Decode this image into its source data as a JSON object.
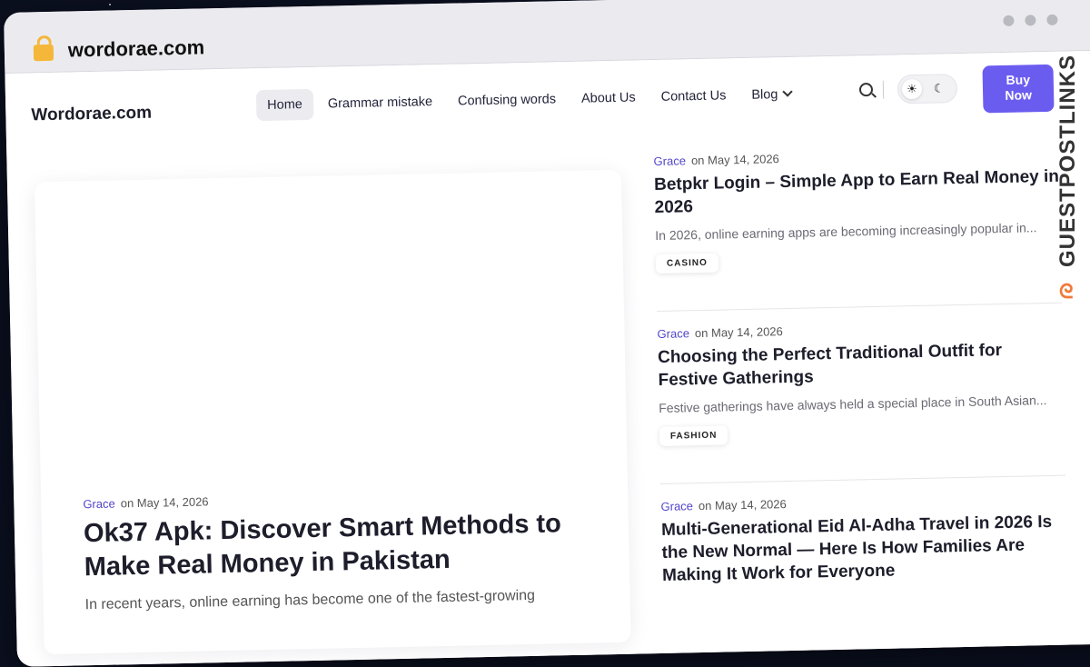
{
  "browser": {
    "url": "wordorae.com"
  },
  "site": {
    "logo": "Wordorae.com",
    "menu": [
      "Home",
      "Grammar mistake",
      "Confusing words",
      "About Us",
      "Contact Us",
      "Blog"
    ],
    "buy_label_line1": "Buy",
    "buy_label_line2": "Now"
  },
  "featured": {
    "author": "Grace",
    "date": "on May 14, 2026",
    "title": "Ok37 Apk: Discover Smart Methods to Make Real Money in Pakistan",
    "excerpt": "In recent years, online earning has become one of the fastest-growing"
  },
  "posts": [
    {
      "author": "Grace",
      "date": "on May 14, 2026",
      "title": "Betpkr Login – Simple App to Earn Real Money in 2026",
      "excerpt": "In 2026, online earning apps are becoming increasingly popular in...",
      "tag": "CASINO"
    },
    {
      "author": "Grace",
      "date": "on May 14, 2026",
      "title": "Choosing the Perfect Traditional Outfit for Festive Gatherings",
      "excerpt": "Festive gatherings have always held a special place in South Asian...",
      "tag": "FASHION"
    },
    {
      "author": "Grace",
      "date": "on May 14, 2026",
      "title": "Multi-Generational Eid Al-Adha Travel in 2026 Is the New Normal — Here Is How Families Are Making It Work for Everyone",
      "excerpt": "",
      "tag": ""
    }
  ],
  "watermark": {
    "text": "GUESTPOSTLINKS"
  }
}
